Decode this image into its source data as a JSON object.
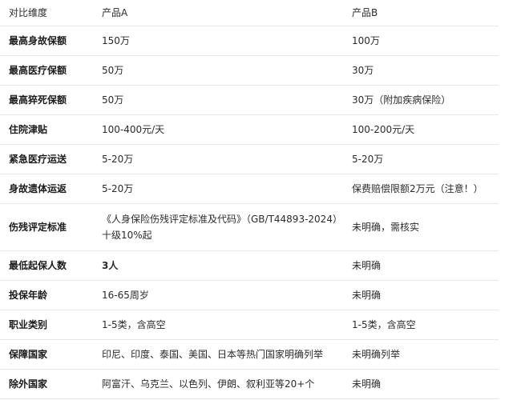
{
  "table": {
    "headers": [
      "对比维度",
      "产品A",
      "产品B"
    ],
    "rows": [
      {
        "dimension": "最高身故保额",
        "a": "150万",
        "b": "100万"
      },
      {
        "dimension": "最高医疗保额",
        "a": "50万",
        "b": "30万"
      },
      {
        "dimension": "最高猝死保额",
        "a": "50万",
        "b": "30万（附加疾病保险）"
      },
      {
        "dimension": "住院津贴",
        "a": "100-400元/天",
        "b": "100-200元/天"
      },
      {
        "dimension": "紧急医疗运送",
        "a": "5-20万",
        "b": "5-20万"
      },
      {
        "dimension": "身故遗体运返",
        "a": "5-20万",
        "b": "保费赔偿限额2万元（注意！）"
      },
      {
        "dimension": "伤残评定标准",
        "a": "《人身保险伤残评定标准及代码》（GB/T44893-2024）十级10%起",
        "b": "未明确，需核实"
      },
      {
        "dimension": "最低起保人数",
        "a": "3人",
        "b": "未明确"
      },
      {
        "dimension": "投保年龄",
        "a": "16-65周岁",
        "b": "未明确"
      },
      {
        "dimension": "职业类别",
        "a": "1-5类，含高空",
        "b": "1-5类，含高空"
      },
      {
        "dimension": "保障国家",
        "a": "印尼、印度、泰国、美国、日本等热门国家明确列举",
        "b": "未明确列举"
      },
      {
        "dimension": "除外国家",
        "a": "阿富汗、乌克兰、以色列、伊朗、叙利亚等20+个",
        "b": "未明确"
      }
    ]
  }
}
